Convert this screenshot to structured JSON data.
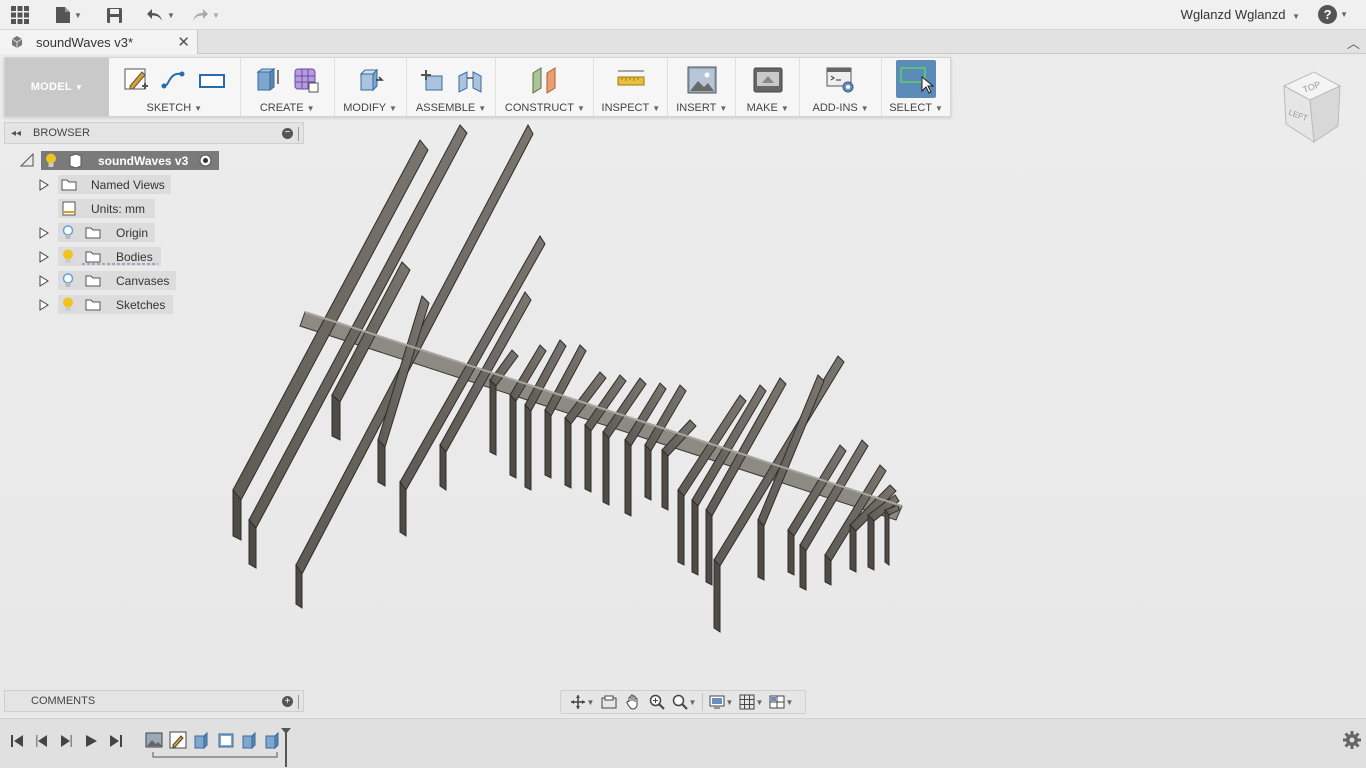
{
  "app": {
    "user_name": "Wglanzd Wglanzd"
  },
  "document": {
    "tab_title": "soundWaves v3*"
  },
  "toolbar": {
    "workspace": "MODEL",
    "groups": [
      {
        "label": "SKETCH"
      },
      {
        "label": "CREATE"
      },
      {
        "label": "MODIFY"
      },
      {
        "label": "ASSEMBLE"
      },
      {
        "label": "CONSTRUCT"
      },
      {
        "label": "INSPECT"
      },
      {
        "label": "INSERT"
      },
      {
        "label": "MAKE"
      },
      {
        "label": "ADD-INS"
      },
      {
        "label": "SELECT"
      }
    ]
  },
  "viewcube": {
    "top_face": "TOP",
    "left_face": "LEFT"
  },
  "browser": {
    "title": "BROWSER",
    "root": "soundWaves v3",
    "items": [
      {
        "label": "Named Views"
      },
      {
        "label": "Units: mm"
      },
      {
        "label": "Origin"
      },
      {
        "label": "Bodies"
      },
      {
        "label": "Canvases"
      },
      {
        "label": "Sketches"
      }
    ]
  },
  "comments": {
    "title": "COMMENTS"
  },
  "colors": {
    "select_active": "#5b8bb8",
    "root_pill": "#7a7a7a",
    "bulb_on": "#f0c420",
    "bulb_off": "#6aa0d8",
    "model_face": "#6b6760",
    "model_top": "#8d8a83"
  }
}
